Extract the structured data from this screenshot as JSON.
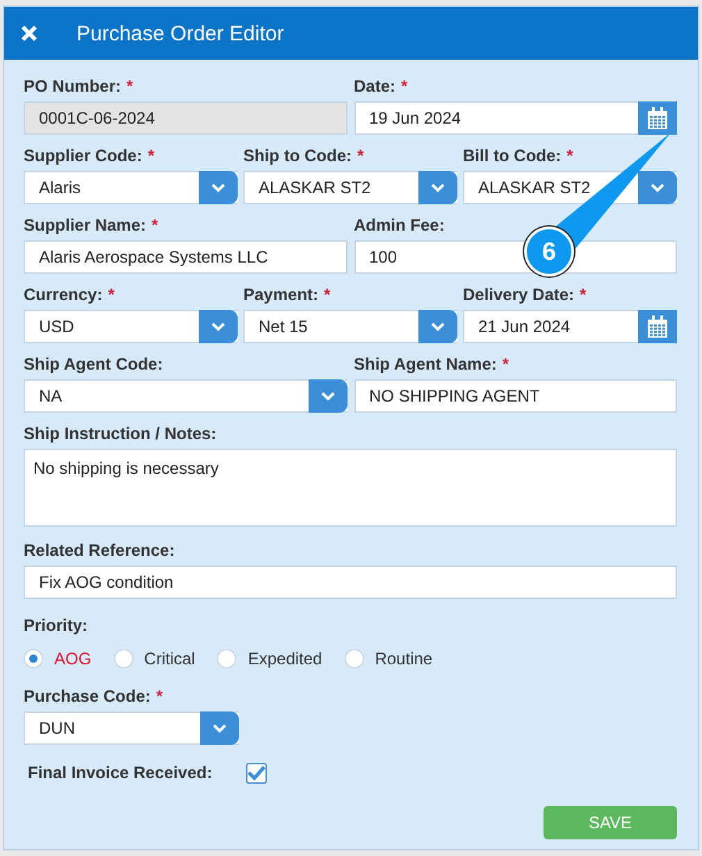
{
  "window": {
    "title": "Purchase Order Editor"
  },
  "rows": [
    {
      "fields": [
        {
          "label": "PO Number:",
          "mark": "*",
          "kind": "readonly",
          "value": "0001C-06-2024"
        },
        {
          "label": "Date:",
          "mark": "*",
          "kind": "date",
          "value": "19 Jun 2024"
        }
      ]
    },
    {
      "fields": [
        {
          "label": "Supplier Code:",
          "mark": "*",
          "kind": "select",
          "value": "Alaris"
        },
        {
          "label": "Ship to Code:",
          "mark": "*",
          "kind": "select",
          "value": "ALASKAR ST2"
        },
        {
          "label": "Bill to Code:",
          "mark": "*",
          "kind": "select",
          "value": "ALASKAR ST2"
        }
      ]
    },
    {
      "fields": [
        {
          "label": "Supplier Name:",
          "mark": "*",
          "kind": "text",
          "value": "Alaris Aerospace Systems LLC"
        },
        {
          "label": "Admin Fee:",
          "kind": "text",
          "value": "100"
        }
      ]
    },
    {
      "fields": [
        {
          "label": "Currency:",
          "mark": "*",
          "kind": "select",
          "value": "USD"
        },
        {
          "label": "Payment:",
          "mark": "*",
          "kind": "select",
          "value": "Net 15"
        },
        {
          "label": "Delivery Date:",
          "mark": "*",
          "kind": "date",
          "value": "21 Jun 2024"
        }
      ]
    },
    {
      "fields": [
        {
          "label": "Ship Agent Code:",
          "kind": "select",
          "value": "NA"
        },
        {
          "label": "Ship Agent Name:",
          "mark": "*",
          "kind": "text",
          "value": "NO SHIPPING AGENT"
        }
      ]
    },
    {
      "fields": [
        {
          "label": "Ship Instruction / Notes:",
          "kind": "textarea",
          "value": "No shipping is necessary"
        }
      ]
    },
    {
      "fields": [
        {
          "label": "Related Reference:",
          "kind": "text",
          "value": "Fix AOG condition"
        }
      ]
    }
  ],
  "priority": {
    "label": "Priority:",
    "options": [
      {
        "label": "AOG",
        "selected": true
      },
      {
        "label": "Critical",
        "selected": false
      },
      {
        "label": "Expedited",
        "selected": false
      },
      {
        "label": "Routine",
        "selected": false
      }
    ]
  },
  "purchase_code": {
    "label": "Purchase Code:",
    "mark": "*",
    "value": "DUN"
  },
  "final_invoice": {
    "label": "Final Invoice Received:",
    "checked": true
  },
  "save_button": "SAVE",
  "callout": {
    "number": "6"
  }
}
